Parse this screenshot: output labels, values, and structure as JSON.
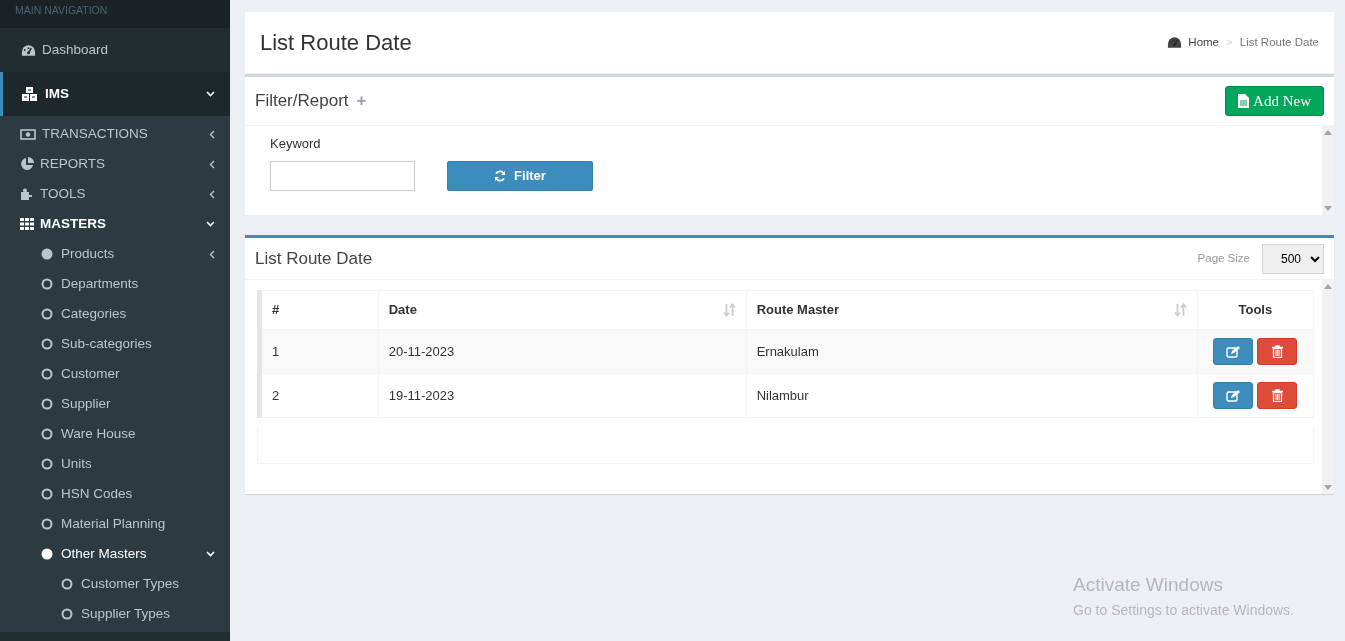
{
  "sidebar": {
    "header": "MAIN NAVIGATION",
    "items": [
      {
        "label": "Dashboard",
        "kind": "link"
      },
      {
        "label": "IMS",
        "kind": "group",
        "expanded": true,
        "children": [
          {
            "label": "TRANSACTIONS",
            "kind": "group",
            "expanded": false
          },
          {
            "label": "REPORTS",
            "kind": "group",
            "expanded": false
          },
          {
            "label": "TOOLS",
            "kind": "group",
            "expanded": false
          },
          {
            "label": "MASTERS",
            "kind": "group",
            "expanded": true,
            "children": [
              {
                "label": "Products",
                "kind": "group",
                "expanded": false
              },
              {
                "label": "Departments",
                "kind": "link"
              },
              {
                "label": "Categories",
                "kind": "link"
              },
              {
                "label": "Sub-categories",
                "kind": "link"
              },
              {
                "label": "Customer",
                "kind": "link"
              },
              {
                "label": "Supplier",
                "kind": "link"
              },
              {
                "label": "Ware House",
                "kind": "link"
              },
              {
                "label": "Units",
                "kind": "link"
              },
              {
                "label": "HSN Codes",
                "kind": "link"
              },
              {
                "label": "Material Planning",
                "kind": "link"
              },
              {
                "label": "Other Masters",
                "kind": "group",
                "expanded": true,
                "children": [
                  {
                    "label": "Customer Types",
                    "kind": "link"
                  },
                  {
                    "label": "Supplier Types",
                    "kind": "link"
                  }
                ]
              }
            ]
          }
        ]
      }
    ]
  },
  "page_header": {
    "title": "List Route Date",
    "breadcrumb": {
      "items": [
        "Home",
        "List Route Date"
      ],
      "separator": ">"
    }
  },
  "filter_panel": {
    "title": "Filter/Report",
    "toggle": "+",
    "add_button": "Add New",
    "keyword_label": "Keyword",
    "filter_button": "Filter"
  },
  "list_panel": {
    "title": "List Route Date",
    "page_size_label": "Page Size",
    "page_size": "500",
    "table": {
      "columns": [
        {
          "label": "#",
          "sortable": false
        },
        {
          "label": "Date",
          "sortable": true
        },
        {
          "label": "Route Master",
          "sortable": true
        },
        {
          "label": "Tools",
          "sortable": false
        }
      ],
      "rows": [
        {
          "number": "1",
          "date": "20-11-2023",
          "route": "Ernakulam"
        },
        {
          "number": "2",
          "date": "19-11-2023",
          "route": "Nilambur"
        }
      ]
    }
  },
  "os_overlay": {
    "title": "Activate Windows",
    "message": "Go to Settings to activate Windows."
  }
}
